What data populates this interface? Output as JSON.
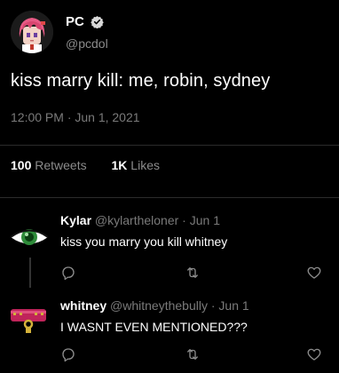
{
  "tweet": {
    "display_name": "PC",
    "handle": "@pcdol",
    "text": "kiss marry kill: me, robin, sydney",
    "timestamp": "12:00 PM · Jun 1, 2021",
    "retweets_count": "100",
    "retweets_label": "Retweets",
    "likes_count": "1K",
    "likes_label": "Likes"
  },
  "replies": [
    {
      "name": "Kylar",
      "handle": "@kylartheloner",
      "date": "Jun 1",
      "separator": " · ",
      "text": "kiss you marry you kill whitney"
    },
    {
      "name": "whitney",
      "handle": "@whitneythebully",
      "date": "Jun 1",
      "separator": " · ",
      "text": "I WASNT EVEN MENTIONED???"
    }
  ],
  "colors": {
    "background": "#000000",
    "text": "#ffffff",
    "muted": "#8b8b8b",
    "divider": "#2b2b2b"
  },
  "icons": [
    "verified-badge-icon",
    "reply-icon",
    "retweet-icon",
    "like-icon"
  ]
}
